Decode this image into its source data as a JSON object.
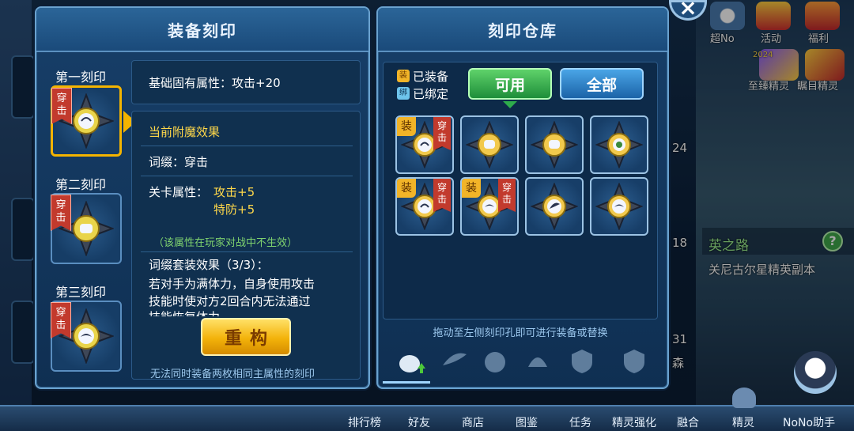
{
  "left_panel": {
    "title": "装备刻印",
    "slots": [
      {
        "label": "第一刻印",
        "tag": "穿击"
      },
      {
        "label": "第二刻印",
        "tag": "穿击"
      },
      {
        "label": "第三刻印",
        "tag": "穿击"
      }
    ],
    "base_attr": "基础固有属性：攻击+20",
    "current_enchant_title": "当前附魔效果",
    "affix": "词缀：穿击",
    "stage_attr_label": "关卡属性：",
    "stage_attr_1": "攻击+5",
    "stage_attr_2": "特防+5",
    "pvp_note": "（该属性在玩家对战中不生效）",
    "set_effect_title": "词缀套装效果（3/3）：",
    "set_effect_line1": "若对手为满体力，自身使用攻击",
    "set_effect_line2": "技能时使对方2回合内无法通过",
    "set_effect_line3": "技能恢复体力",
    "rebuild_button": "重构",
    "footer_note": "无法同时装备两枚相同主属性的刻印"
  },
  "right_panel": {
    "title": "刻印仓库",
    "legend_equipped_badge": "装",
    "legend_equipped": "已装备",
    "legend_bound_badge": "绑",
    "legend_bound": "已绑定",
    "filter_available": "可用",
    "filter_all": "全部",
    "cells": [
      {
        "equip": "装",
        "tag": "穿击",
        "color": "#f2c94c"
      },
      {
        "equip": "",
        "tag": "",
        "color": "#f2c94c"
      },
      {
        "equip": "",
        "tag": "",
        "color": "#f2c94c"
      },
      {
        "equip": "",
        "tag": "",
        "color": "#f2c94c"
      },
      {
        "equip": "装",
        "tag": "穿击",
        "color": "#f2c94c"
      },
      {
        "equip": "装",
        "tag": "穿击",
        "color": "#f2c94c"
      },
      {
        "equip": "",
        "tag": "",
        "color": "#f2c94c"
      },
      {
        "equip": "",
        "tag": "",
        "color": "#f2c94c"
      }
    ],
    "hint": "拖动至左侧刻印孔即可进行装备或替换",
    "category_tabs": [
      "sword-icon",
      "feather-icon",
      "orb-icon",
      "bird-icon",
      "shield-crest-icon",
      "shield-crest-icon"
    ]
  },
  "top_right": {
    "items": [
      {
        "label": "超No"
      },
      {
        "label": "活动"
      },
      {
        "label": "福利"
      }
    ],
    "elite_1": "至臻精灵",
    "elite_2": "瞩目精灵",
    "year_badge": "2024"
  },
  "side": {
    "road": "英之路",
    "dungeon": "关尼古尔星精英副本",
    "num_24": "24",
    "num_18": "18",
    "num_31": "31",
    "forest": "森"
  },
  "bottom_bar": {
    "items": [
      "排行榜",
      "好友",
      "商店",
      "图鉴",
      "任务",
      "精灵强化",
      "融合",
      "精灵",
      "NoNo助手"
    ]
  },
  "colors": {
    "accent_gold": "#f4b400",
    "tag_red": "#c23a2d",
    "panel_blue": "#173f69",
    "available_green": "#2eac4b"
  }
}
